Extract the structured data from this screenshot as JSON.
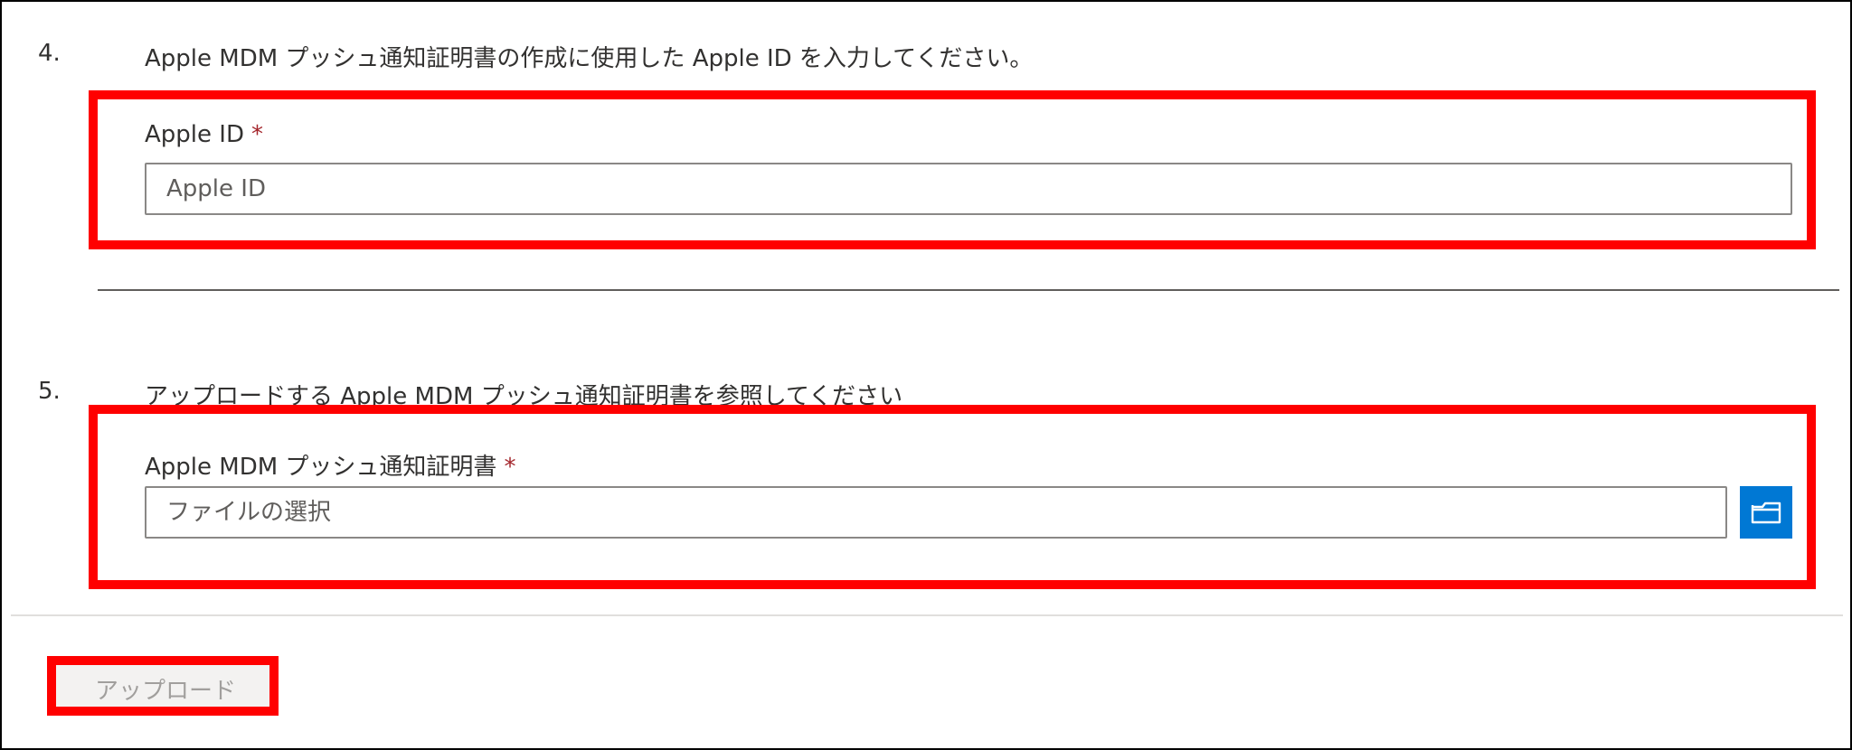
{
  "steps": [
    {
      "number": "4.",
      "instruction": "Apple MDM プッシュ通知証明書の作成に使用した Apple ID を入力してください。",
      "field": {
        "label": "Apple ID",
        "required_marker": "*",
        "placeholder": "Apple ID",
        "value": ""
      }
    },
    {
      "number": "5.",
      "instruction": "アップロードする Apple MDM プッシュ通知証明書を参照してください",
      "field": {
        "label": "Apple MDM プッシュ通知証明書",
        "required_marker": "*",
        "placeholder": "ファイルの選択",
        "value": "",
        "browse_icon": "folder-icon"
      }
    }
  ],
  "footer": {
    "upload_label": "アップロード",
    "upload_disabled": true
  },
  "colors": {
    "highlight": "#ff0000",
    "required": "#a4262c",
    "browse_button": "#0078d4",
    "text": "#323130"
  }
}
